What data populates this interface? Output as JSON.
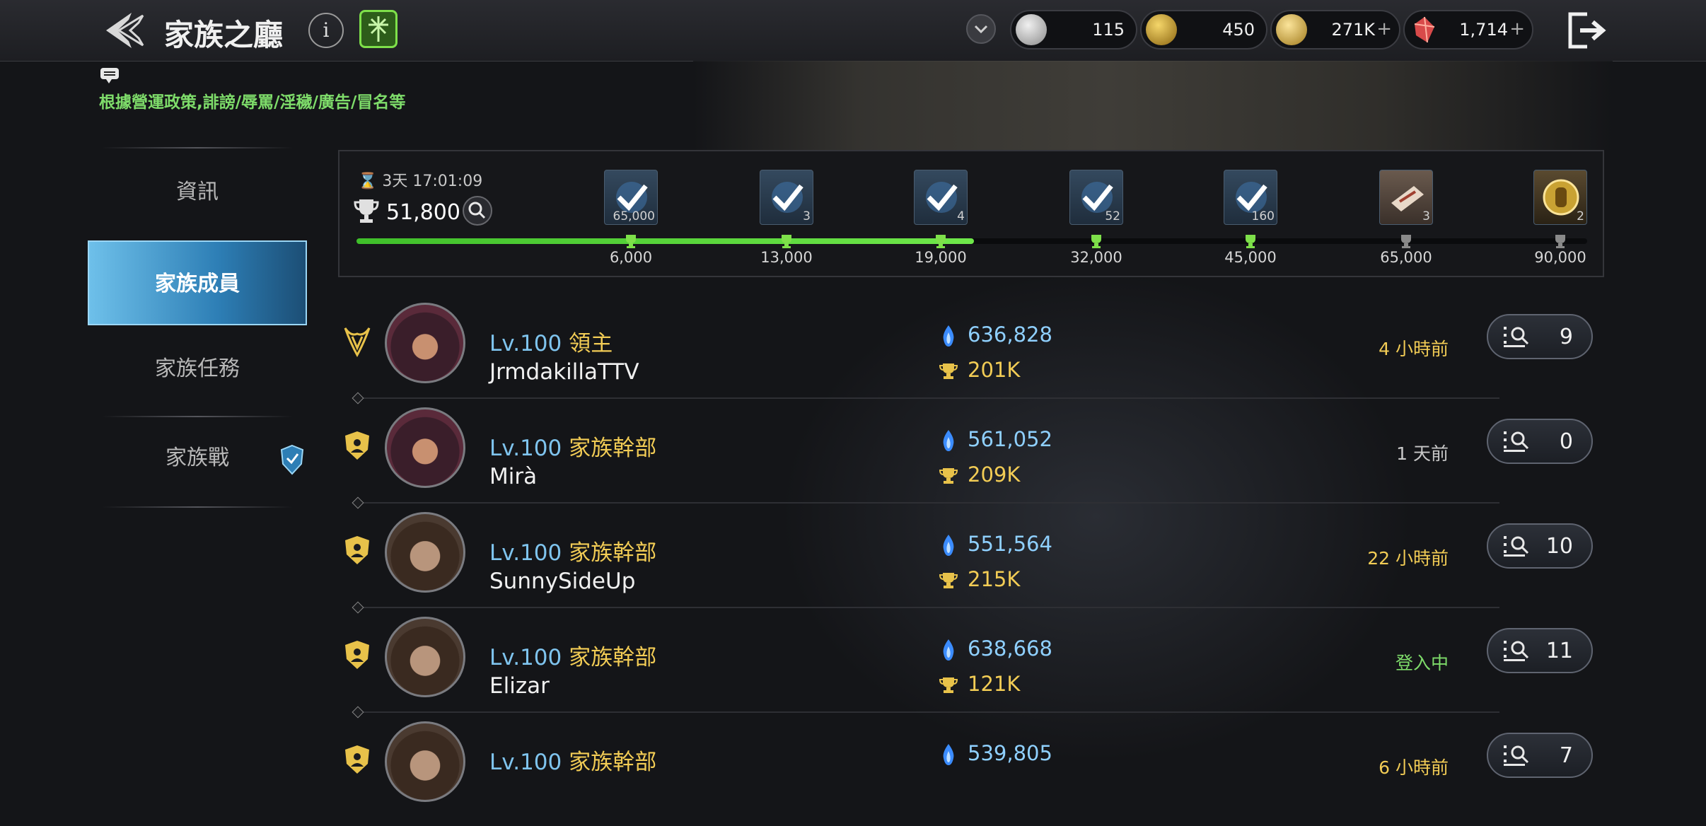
{
  "header": {
    "title": "家族之廳",
    "info_label": "i",
    "currencies": [
      {
        "name": "silver-coin-icon",
        "value": "115",
        "color": "#bfbfbf"
      },
      {
        "name": "gold-medal-icon",
        "value": "450",
        "color": "#c9a233"
      },
      {
        "name": "gold-coin-icon",
        "value": "271K",
        "color": "#d7b44a"
      },
      {
        "name": "red-crystal-icon",
        "value": "1,714",
        "color": "#d84a4a"
      }
    ],
    "plus_sign": "+"
  },
  "notice": {
    "text": "根據營運政策,誹謗/辱罵/淫穢/廣告/冒名等"
  },
  "sidebar": {
    "items": [
      {
        "label": "資訊",
        "active": false
      },
      {
        "label": "家族成員",
        "active": true
      },
      {
        "label": "家族任務",
        "active": false
      },
      {
        "label": "家族戰",
        "active": false
      }
    ]
  },
  "progress": {
    "timer": "3天 17:01:09",
    "score": "51,800",
    "fill_fraction": 0.502,
    "milestones": [
      {
        "threshold": "6,000",
        "count": "65,000",
        "claimed": true
      },
      {
        "threshold": "13,000",
        "count": "3",
        "claimed": true
      },
      {
        "threshold": "19,000",
        "count": "4",
        "claimed": true
      },
      {
        "threshold": "32,000",
        "count": "52",
        "claimed": true
      },
      {
        "threshold": "45,000",
        "count": "160",
        "claimed": true
      },
      {
        "threshold": "65,000",
        "count": "3",
        "claimed": false
      },
      {
        "threshold": "90,000",
        "count": "2",
        "claimed": false
      }
    ]
  },
  "members": [
    {
      "level": "Lv.100",
      "role": "領主",
      "name": "JrmdakillaTTV",
      "power": "636,828",
      "contribution": "201K",
      "last_seen": "4 小時前",
      "last_seen_color": "#f2cc55",
      "detail_count": "9",
      "badge": "lord-emblem-icon"
    },
    {
      "level": "Lv.100",
      "role": "家族幹部",
      "name": "Mirà",
      "power": "561,052",
      "contribution": "209K",
      "last_seen": "1 天前",
      "last_seen_color": "#c8c8c8",
      "detail_count": "0",
      "badge": "officer-shield-icon"
    },
    {
      "level": "Lv.100",
      "role": "家族幹部",
      "name": "SunnySideUp",
      "power": "551,564",
      "contribution": "215K",
      "last_seen": "22 小時前",
      "last_seen_color": "#f2cc55",
      "detail_count": "10",
      "badge": "officer-shield-icon"
    },
    {
      "level": "Lv.100",
      "role": "家族幹部",
      "name": "Elizar",
      "power": "638,668",
      "contribution": "121K",
      "last_seen": "登入中",
      "last_seen_color": "#7edc6a",
      "detail_count": "11",
      "badge": "officer-shield-icon"
    },
    {
      "level": "Lv.100",
      "role": "家族幹部",
      "name": "",
      "power": "539,805",
      "contribution": "",
      "last_seen": "6 小時前",
      "last_seen_color": "#f2cc55",
      "detail_count": "7",
      "badge": "officer-shield-icon"
    }
  ]
}
